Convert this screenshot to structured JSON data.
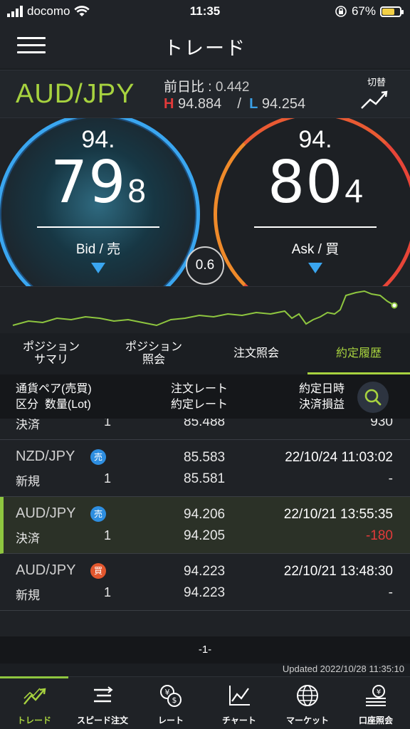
{
  "status": {
    "carrier": "docomo",
    "time": "11:35",
    "battery": "67%",
    "battery_level": 0.67
  },
  "header": {
    "title": "トレード"
  },
  "pair": {
    "name": "AUD/JPY",
    "diff_label": "前日比 : ",
    "diff_value": "0.442",
    "high_label": "H",
    "high": "94.884",
    "sep": "/",
    "low_label": "L",
    "low": "94.254",
    "switch_label": "切替"
  },
  "bid": {
    "prefix": "94.",
    "main": "79",
    "sub": "8",
    "label": "Bid / 売"
  },
  "ask": {
    "prefix": "94.",
    "main": "80",
    "sub": "4",
    "label": "Ask / 買"
  },
  "spread": "0.6",
  "tabs": [
    {
      "label": "ポジション\nサマリ"
    },
    {
      "label": "ポジション\n照会"
    },
    {
      "label": "注文照会"
    },
    {
      "label": "約定履歴"
    }
  ],
  "columns": {
    "c1a": "通貨ペア(売買)",
    "c1b": "区分  数量(Lot)",
    "c2a": "注文レート",
    "c2b": "約定レート",
    "c3a": "約定日時",
    "c3b": "決済損益"
  },
  "rows": [
    {
      "pair": "",
      "side": "",
      "side_label": "",
      "kind": "決済",
      "qty": "1",
      "order_rate": "",
      "fill_rate": "85.488",
      "datetime": "",
      "pl": "930"
    },
    {
      "pair": "NZD/JPY",
      "side": "sell",
      "side_label": "売",
      "kind": "新規",
      "qty": "1",
      "order_rate": "85.583",
      "fill_rate": "85.581",
      "datetime": "22/10/24 11:03:02",
      "pl": "-"
    },
    {
      "pair": "AUD/JPY",
      "side": "sell",
      "side_label": "売",
      "kind": "決済",
      "qty": "1",
      "order_rate": "94.206",
      "fill_rate": "94.205",
      "datetime": "22/10/21 13:55:35",
      "pl": "-180"
    },
    {
      "pair": "AUD/JPY",
      "side": "buy",
      "side_label": "買",
      "kind": "新規",
      "qty": "1",
      "order_rate": "94.223",
      "fill_rate": "94.223",
      "datetime": "22/10/21 13:48:30",
      "pl": "-"
    }
  ],
  "pager": "-1-",
  "updated": "Updated  2022/10/28 11:35:10",
  "nav": [
    {
      "label": "トレード",
      "icon": "trend-icon"
    },
    {
      "label": "スピード注文",
      "icon": "speed-order-icon"
    },
    {
      "label": "レート",
      "icon": "rate-icon"
    },
    {
      "label": "チャート",
      "icon": "chart-icon"
    },
    {
      "label": "マーケット",
      "icon": "globe-icon"
    },
    {
      "label": "口座照会",
      "icon": "account-icon"
    }
  ],
  "colors": {
    "accent": "#a7d23f",
    "bid": "#3aa6f0",
    "ask": "#e74538",
    "negative": "#e23a3a"
  }
}
